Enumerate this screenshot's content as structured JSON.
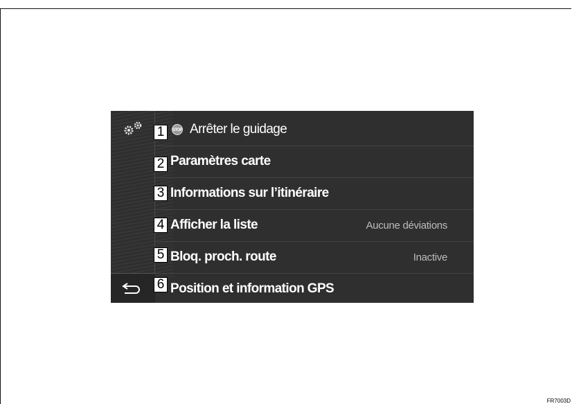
{
  "menu": {
    "items": [
      {
        "number": "1",
        "label": "Arrêter le guidage",
        "value": "",
        "icon": "stop-icon",
        "icon_text": "STOP"
      },
      {
        "number": "2",
        "label": "Paramètres carte",
        "value": ""
      },
      {
        "number": "3",
        "label": "Informations sur l’itinéraire",
        "value": ""
      },
      {
        "number": "4",
        "label": "Afficher la liste",
        "value": "Aucune déviations"
      },
      {
        "number": "5",
        "label": "Bloq. proch. route",
        "value": "Inactive"
      },
      {
        "number": "6",
        "label": "Position et information GPS",
        "value": ""
      }
    ]
  },
  "sidebar": {
    "top_icon": "gear-icon",
    "back_icon": "back-arrow-icon"
  },
  "figure_code": "FR7003D"
}
